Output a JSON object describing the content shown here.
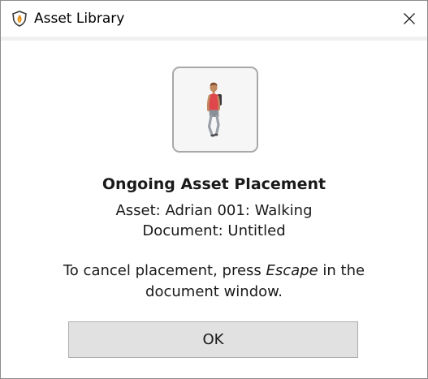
{
  "window": {
    "title": "Asset Library",
    "app_icon": "shield-flame-icon",
    "close_icon": "close-icon"
  },
  "dialog": {
    "thumbnail": "walking-person-thumbnail",
    "heading": "Ongoing Asset Placement",
    "asset_line": "Asset: Adrian 001: Walking",
    "document_line": "Document: Untitled",
    "instructions_before": "To cancel placement, press ",
    "instructions_key": "Escape",
    "instructions_after": " in the document window.",
    "ok_label": "OK"
  },
  "colors": {
    "accent_orange": "#e88a1a",
    "button_bg": "#e1e1e1",
    "thumbnail_shirt": "#e0474c"
  }
}
